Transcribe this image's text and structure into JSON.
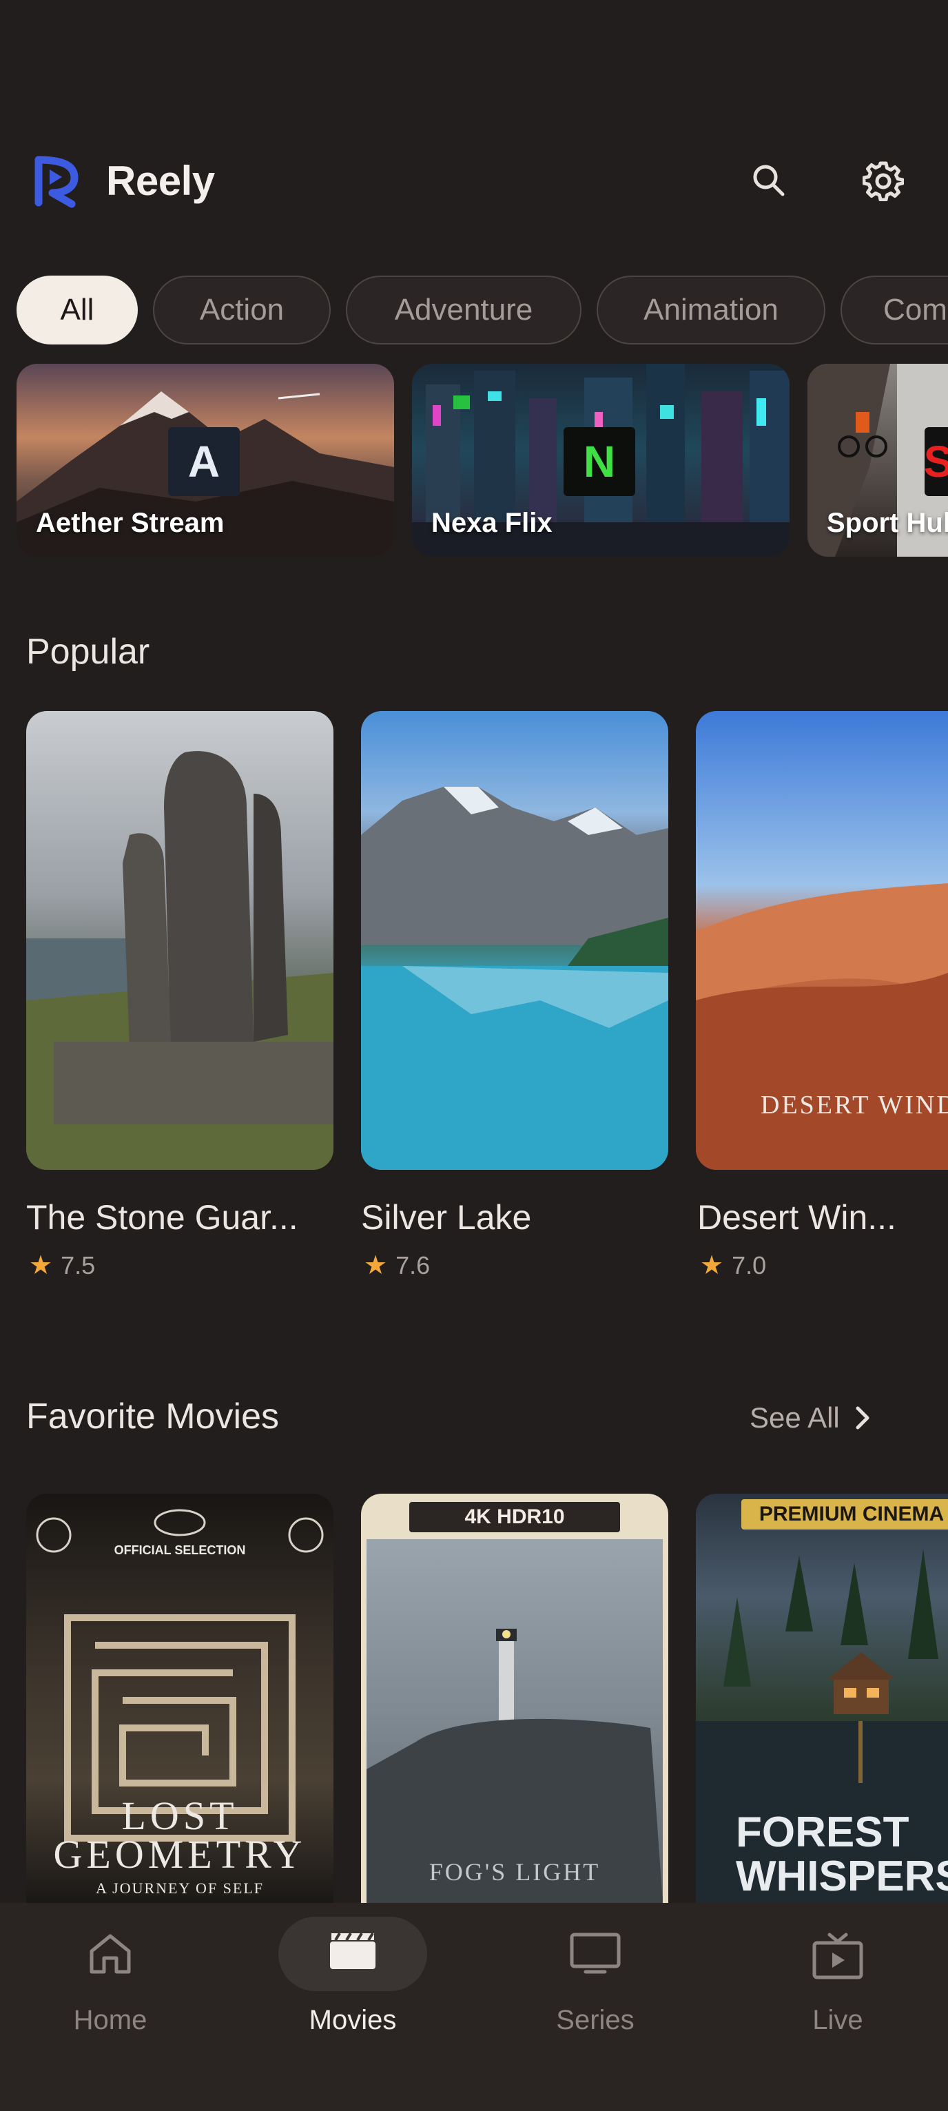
{
  "app": {
    "title": "Reely"
  },
  "colors": {
    "accent": "#3d5be0",
    "background": "#221e1d",
    "star": "#f4a83a",
    "chip_active": "#f3ede6"
  },
  "header": {
    "icons": [
      "search-icon",
      "gear-icon"
    ]
  },
  "genres": [
    {
      "label": "All",
      "active": true
    },
    {
      "label": "Action",
      "active": false
    },
    {
      "label": "Adventure",
      "active": false
    },
    {
      "label": "Animation",
      "active": false
    },
    {
      "label": "Com",
      "active": false
    }
  ],
  "providers": [
    {
      "name": "Aether Stream",
      "badge": "A"
    },
    {
      "name": "Nexa Flix",
      "badge": "N"
    },
    {
      "name": "Sport Hub",
      "badge": "S"
    }
  ],
  "popular": {
    "title": "Popular",
    "movies": [
      {
        "title": "The Stone Guar...",
        "rating": "7.5"
      },
      {
        "title": "Silver Lake",
        "rating": "7.6"
      },
      {
        "title": "Desert Win...",
        "rating": "7.0",
        "poster_text": "DESERT WIND"
      }
    ]
  },
  "favorites": {
    "title": "Favorite Movies",
    "see_all": "See All",
    "movies": [
      {
        "poster_title": "LOST GEOMETRY",
        "poster_tagline": "A JOURNEY OF SELF",
        "poster_badge": "OFFICIAL SELECTION"
      },
      {
        "poster_title": "FOG'S LIGHT",
        "poster_badge": "4K HDR10"
      },
      {
        "poster_title": "FOREST WHISPERS",
        "poster_badge": "PREMIUM CINEMA"
      }
    ]
  },
  "nav": [
    {
      "label": "Home",
      "icon": "home-icon",
      "active": false
    },
    {
      "label": "Movies",
      "icon": "clapperboard-icon",
      "active": true
    },
    {
      "label": "Series",
      "icon": "tv-icon",
      "active": false
    },
    {
      "label": "Live",
      "icon": "live-tv-icon",
      "active": false
    }
  ]
}
